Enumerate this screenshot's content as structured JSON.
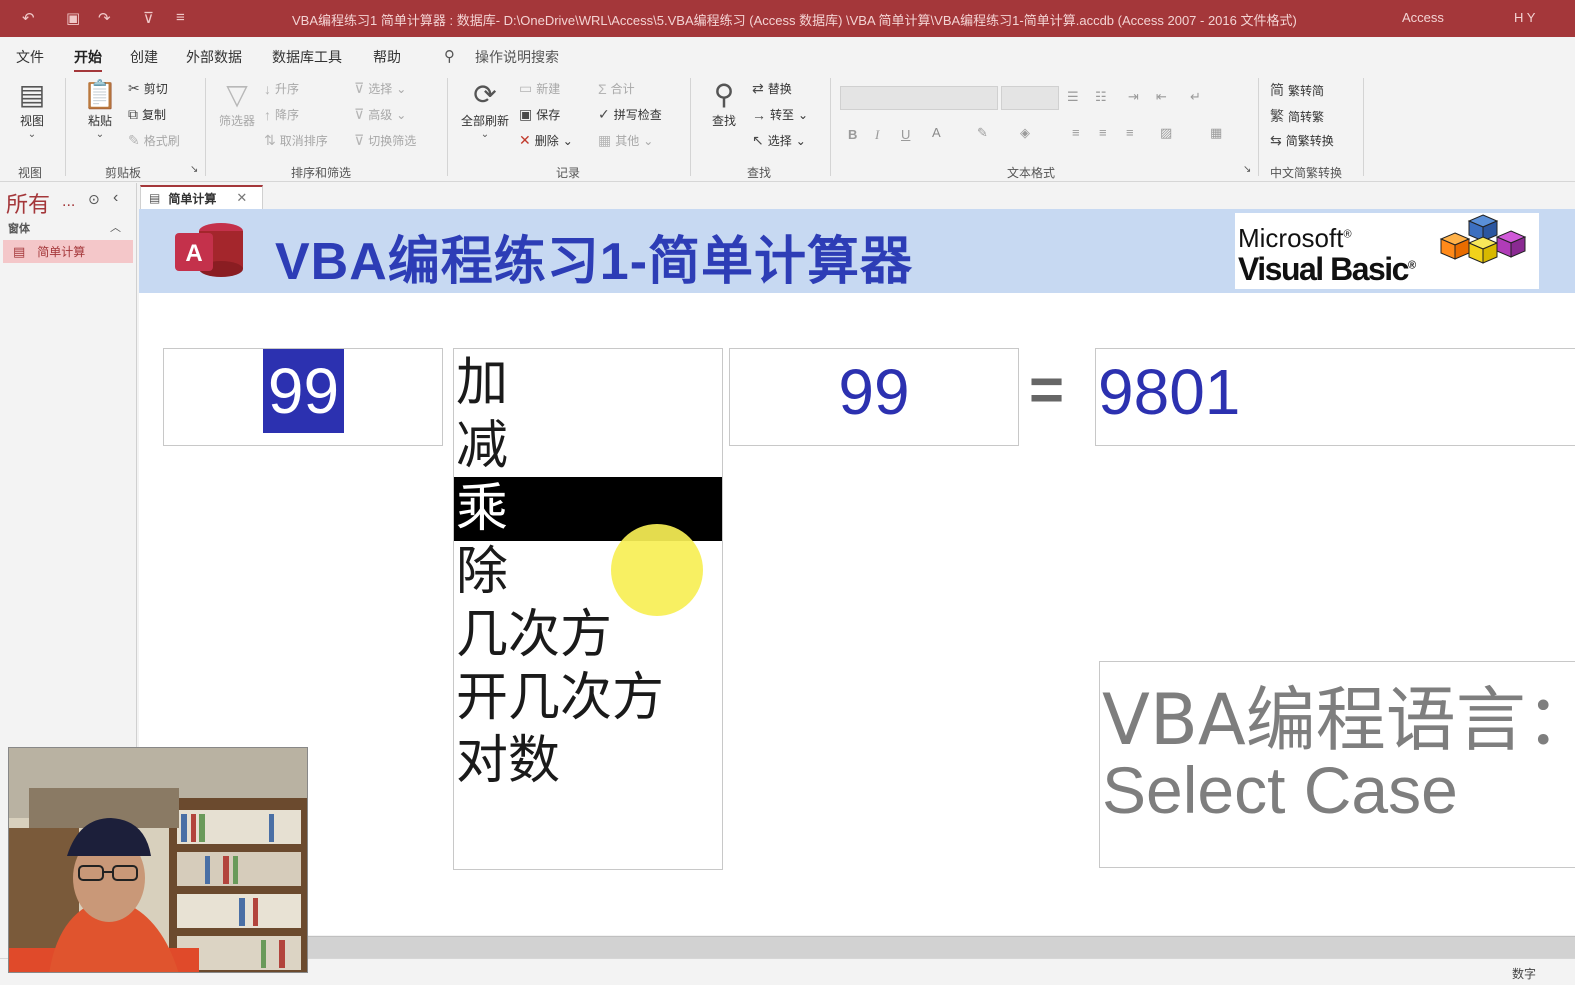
{
  "titlebar": {
    "title": "VBA编程练习1 简单计算器 : 数据库- D:\\OneDrive\\WRL\\Access\\5.VBA编程练习 (Access 数据库) \\VBA 简单计算\\VBA编程练习1-简单计算.accdb (Access 2007 - 2016 文件格式)",
    "app_name": "Access",
    "user": "H Y"
  },
  "menu": {
    "tabs": [
      "文件",
      "开始",
      "创建",
      "外部数据",
      "数据库工具",
      "帮助"
    ],
    "search_placeholder": "操作说明搜索"
  },
  "ribbon": {
    "views": {
      "button": "视图",
      "group": "视图"
    },
    "clipboard": {
      "paste": "粘贴",
      "cut": "剪切",
      "copy": "复制",
      "format_painter": "格式刷",
      "group": "剪贴板"
    },
    "sort_filter": {
      "filter": "筛选器",
      "ascending": "升序",
      "descending": "降序",
      "remove_sort": "取消排序",
      "selection": "选择",
      "advanced": "高级",
      "toggle_filter": "切换筛选",
      "group": "排序和筛选"
    },
    "records": {
      "refresh_all": "全部刷新",
      "new": "新建",
      "save": "保存",
      "delete": "删除",
      "totals": "合计",
      "spelling": "拼写检查",
      "more": "其他",
      "group": "记录"
    },
    "find": {
      "find": "查找",
      "replace": "替换",
      "goto": "转至",
      "select": "选择",
      "group": "查找"
    },
    "text_format": {
      "bold": "B",
      "italic": "I",
      "underline": "U",
      "group": "文本格式"
    },
    "chinese_conversion": {
      "to_simplified_trad": "繁转简",
      "to_traditional": "简转繁",
      "convert": "简繁转换",
      "group": "中文简繁转换"
    }
  },
  "navpane": {
    "title": "所有",
    "more": "...",
    "section": "窗体",
    "item": "简单计算"
  },
  "doc_tab": {
    "label": "简单计算"
  },
  "form": {
    "title": "VBA编程练习1-简单计算器",
    "logo_letter": "A",
    "vb_logo": {
      "microsoft": "Microsoft",
      "visual_basic": "Visual Basic",
      "reg1": "®",
      "reg2": "®"
    },
    "operand1": "99",
    "operations": [
      "加",
      "减",
      "乘",
      "除",
      "几次方",
      "开几次方",
      "对数"
    ],
    "selected_operation": "乘",
    "operand2": "99",
    "equals": "=",
    "result": "9801",
    "note_line1": "VBA编程语言：",
    "note_line2": "Select Case"
  },
  "statusbar": {
    "mode": "数字"
  },
  "colors": {
    "accent": "#a4373a",
    "form_header": "#c7d9f2",
    "value_blue": "#2c31b0",
    "cursor_highlight": "#f7ef55"
  }
}
